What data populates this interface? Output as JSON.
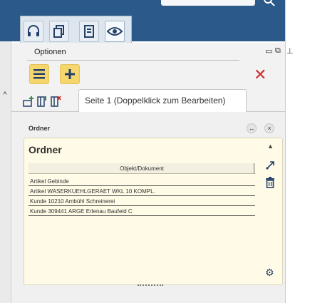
{
  "topbar": {
    "search_icon": "search-icon"
  },
  "tabs": [
    {
      "name": "headset-icon"
    },
    {
      "name": "copy-documents-icon"
    },
    {
      "name": "document-icon"
    },
    {
      "name": "eye-icon",
      "active": true
    }
  ],
  "options": {
    "label": "Optionen",
    "menu_icon": "hamburger-icon",
    "add_icon": "plus-icon",
    "close_icon": "close-icon"
  },
  "page_tab": {
    "label": "Seite 1 (Doppelklick zum Bearbeiten)"
  },
  "panel": {
    "header_label": "Ordner",
    "title": "Ordner",
    "column_header": "Objekt/Dokument",
    "rows": [
      "Artikel Gebinde",
      "Artikel WASERKUEHLGERAET WKL 10 KOMPL.",
      "Kunde 10210 Ambühl Schreinerei",
      "Kunde 309441 ARGE Erlenau Baufeld C"
    ]
  },
  "colors": {
    "topbar": "#2b5a8a",
    "accent_yellow": "#f5d76e",
    "icon_blue": "#23406b",
    "close_red": "#cc2b2b",
    "card_bg": "#fffbe6"
  }
}
